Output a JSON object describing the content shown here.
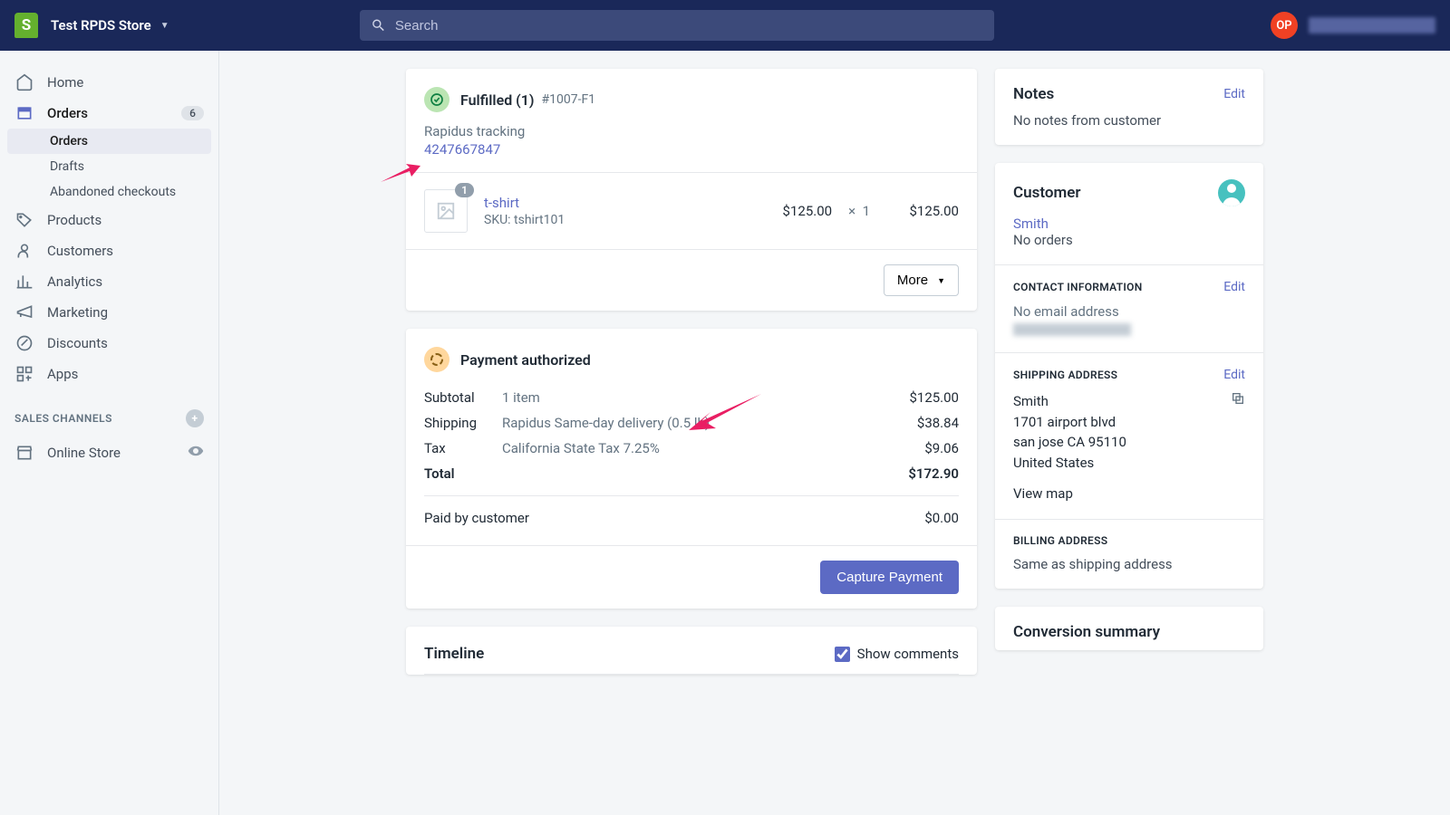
{
  "topbar": {
    "store": "Test RPDS Store",
    "search_placeholder": "Search",
    "avatar_initials": "OP"
  },
  "sidebar": {
    "home": "Home",
    "orders": "Orders",
    "orders_badge": "6",
    "sub_orders": "Orders",
    "sub_drafts": "Drafts",
    "sub_abandoned": "Abandoned checkouts",
    "products": "Products",
    "customers": "Customers",
    "analytics": "Analytics",
    "marketing": "Marketing",
    "discounts": "Discounts",
    "apps": "Apps",
    "sales_channels": "SALES CHANNELS",
    "online_store": "Online Store"
  },
  "fulfilled": {
    "title": "Fulfilled (1)",
    "sub": "#1007-F1",
    "tracking_label": "Rapidus tracking",
    "tracking_number": "4247667847",
    "item_badge": "1",
    "item_name": "t-shirt",
    "item_sku": "SKU: tshirt101",
    "item_price": "$125.00",
    "item_mult": "×",
    "item_qty": "1",
    "item_total": "$125.00",
    "more": "More"
  },
  "payment": {
    "title": "Payment authorized",
    "subtotal_lbl": "Subtotal",
    "subtotal_detail": "1 item",
    "subtotal_amt": "$125.00",
    "shipping_lbl": "Shipping",
    "shipping_detail": "Rapidus Same-day delivery (0.5 lb)",
    "shipping_amt": "$38.84",
    "tax_lbl": "Tax",
    "tax_detail": "California State Tax 7.25%",
    "tax_amt": "$9.06",
    "total_lbl": "Total",
    "total_amt": "$172.90",
    "paid_lbl": "Paid by customer",
    "paid_amt": "$0.00",
    "capture": "Capture Payment"
  },
  "timeline": {
    "title": "Timeline",
    "show_comments": "Show comments"
  },
  "notes": {
    "title": "Notes",
    "edit": "Edit",
    "body": "No notes from customer"
  },
  "customer": {
    "title": "Customer",
    "name": "Smith",
    "orders": "No orders",
    "contact_label": "CONTACT INFORMATION",
    "edit": "Edit",
    "no_email": "No email address",
    "shipping_label": "SHIPPING ADDRESS",
    "addr_name": "Smith",
    "addr_street": "1701 airport blvd",
    "addr_city": "san jose CA 95110",
    "addr_country": "United States",
    "view_map": "View map",
    "billing_label": "BILLING ADDRESS",
    "billing_body": "Same as shipping address"
  },
  "conversion": {
    "title": "Conversion summary"
  }
}
